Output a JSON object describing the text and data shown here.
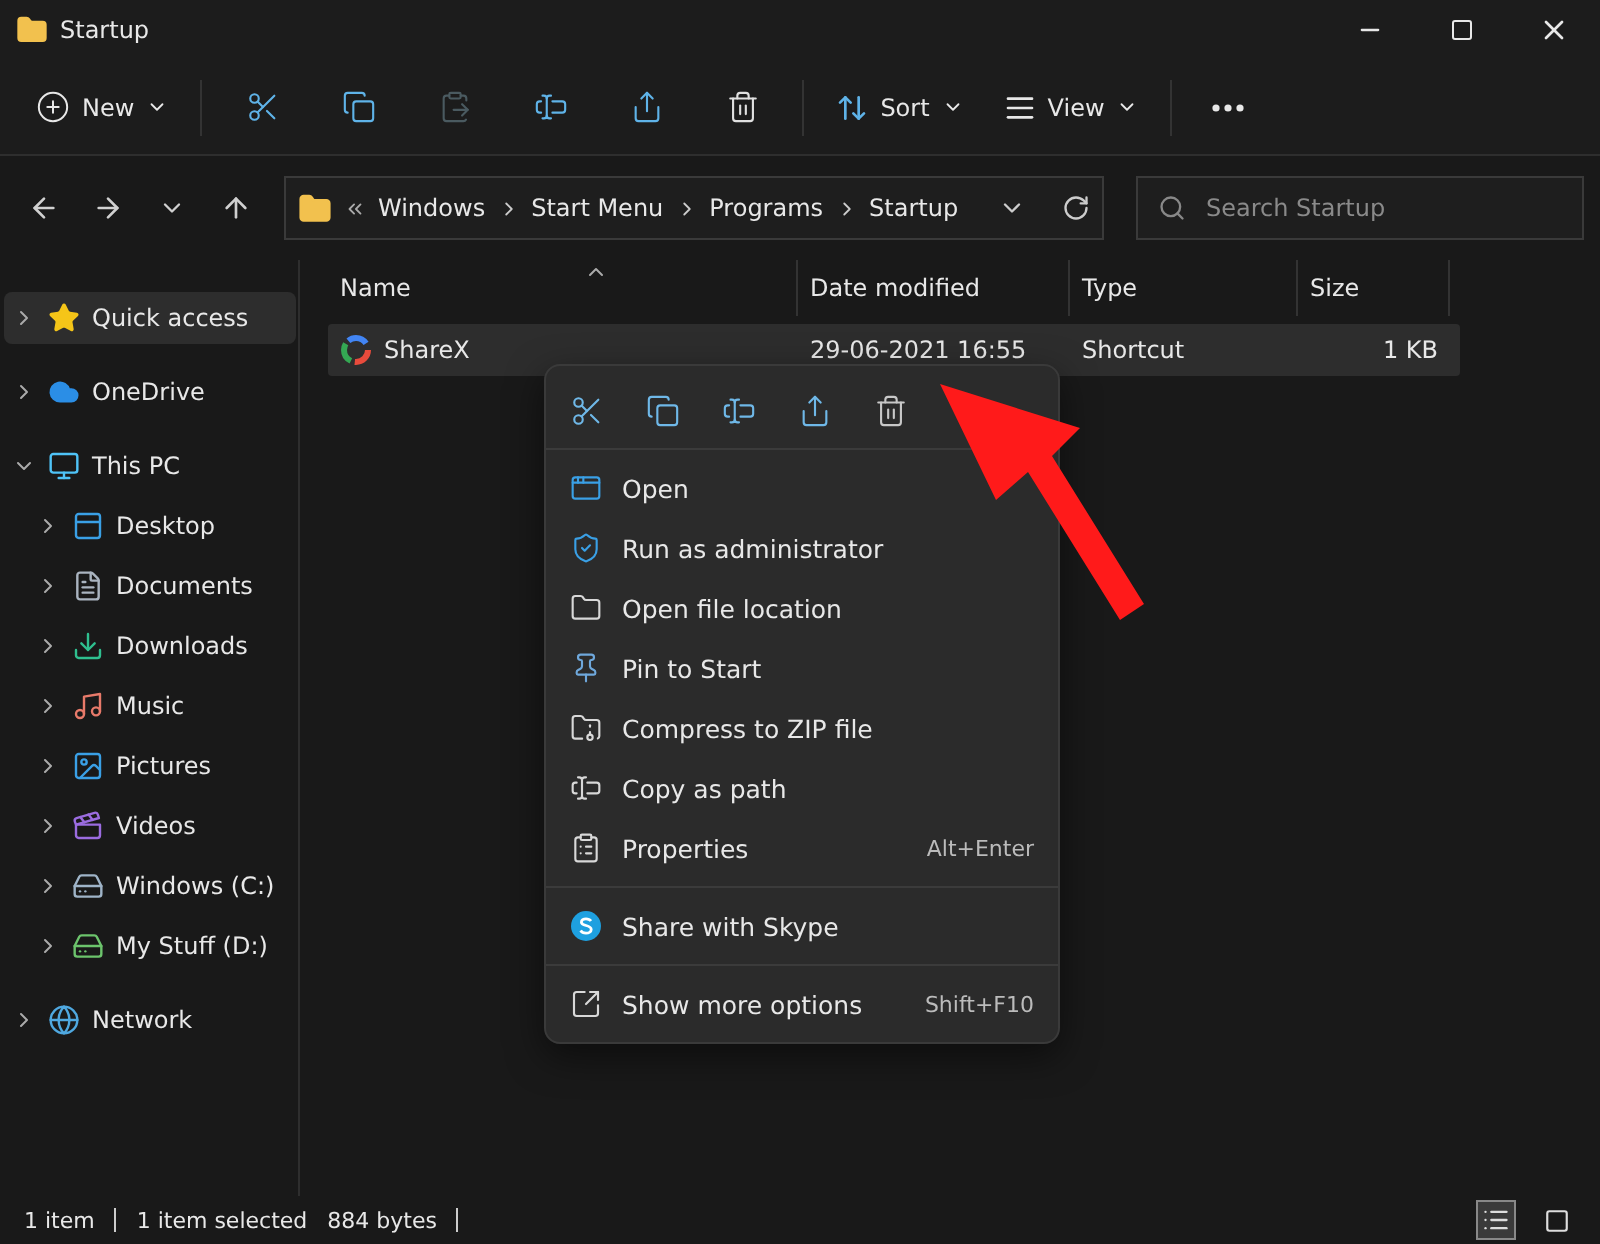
{
  "window": {
    "title": "Startup"
  },
  "toolbar": {
    "new_label": "New",
    "actions": [
      {
        "kind": "cut",
        "disabled": false
      },
      {
        "kind": "copy",
        "disabled": false
      },
      {
        "kind": "paste",
        "disabled": true
      },
      {
        "kind": "rename",
        "disabled": false
      },
      {
        "kind": "share",
        "disabled": false
      },
      {
        "kind": "delete",
        "disabled": false
      }
    ],
    "sort_label": "Sort",
    "view_label": "View"
  },
  "address": {
    "segments": [
      "Windows",
      "Start Menu",
      "Programs",
      "Startup"
    ],
    "search_placeholder": "Search Startup"
  },
  "sidebar": [
    {
      "label": "Quick access",
      "kind": "star",
      "selected": true,
      "expanded": false
    },
    {
      "label": "OneDrive",
      "kind": "cloud",
      "selected": false,
      "expanded": false
    },
    {
      "label": "This PC",
      "kind": "pc",
      "selected": false,
      "expanded": true,
      "children": [
        {
          "label": "Desktop",
          "kind": "desktop",
          "selected": false,
          "expanded": false
        },
        {
          "label": "Documents",
          "kind": "documents",
          "selected": false,
          "expanded": false
        },
        {
          "label": "Downloads",
          "kind": "downloads",
          "selected": false,
          "expanded": false
        },
        {
          "label": "Music",
          "kind": "music",
          "selected": false,
          "expanded": false
        },
        {
          "label": "Pictures",
          "kind": "pictures",
          "selected": false,
          "expanded": false
        },
        {
          "label": "Videos",
          "kind": "videos",
          "selected": false,
          "expanded": false
        },
        {
          "label": "Windows (C:)",
          "kind": "drive",
          "selected": false,
          "expanded": false
        },
        {
          "label": "My Stuff (D:)",
          "kind": "netdrive",
          "selected": false,
          "expanded": false
        }
      ]
    },
    {
      "label": "Network",
      "kind": "network",
      "selected": false,
      "expanded": false
    }
  ],
  "table": {
    "columns": [
      "Name",
      "Date modified",
      "Type",
      "Size"
    ],
    "rows": [
      {
        "name": "ShareX",
        "date": "29-06-2021 16:55",
        "type": "Shortcut",
        "size": "1 KB",
        "selected": true
      }
    ]
  },
  "context_menu": {
    "actions": [
      {
        "kind": "cut"
      },
      {
        "kind": "copy"
      },
      {
        "kind": "rename"
      },
      {
        "kind": "share"
      },
      {
        "kind": "delete"
      }
    ],
    "groups": [
      [
        {
          "label": "Open",
          "kind": "open"
        },
        {
          "label": "Run as administrator",
          "kind": "admin"
        },
        {
          "label": "Open file location",
          "kind": "folder"
        },
        {
          "label": "Pin to Start",
          "kind": "pin"
        },
        {
          "label": "Compress to ZIP file",
          "kind": "zip"
        },
        {
          "label": "Copy as path",
          "kind": "path"
        },
        {
          "label": "Properties",
          "kind": "properties",
          "shortcut": "Alt+Enter"
        }
      ],
      [
        {
          "label": "Share with Skype",
          "kind": "skype"
        }
      ],
      [
        {
          "label": "Show more options",
          "kind": "more",
          "shortcut": "Shift+F10"
        }
      ]
    ]
  },
  "status_bar": {
    "count": "1 item",
    "selection": "1 item selected",
    "size": "884 bytes",
    "views": [
      {
        "kind": "details",
        "selected": true
      },
      {
        "kind": "tiles",
        "selected": false
      }
    ]
  }
}
